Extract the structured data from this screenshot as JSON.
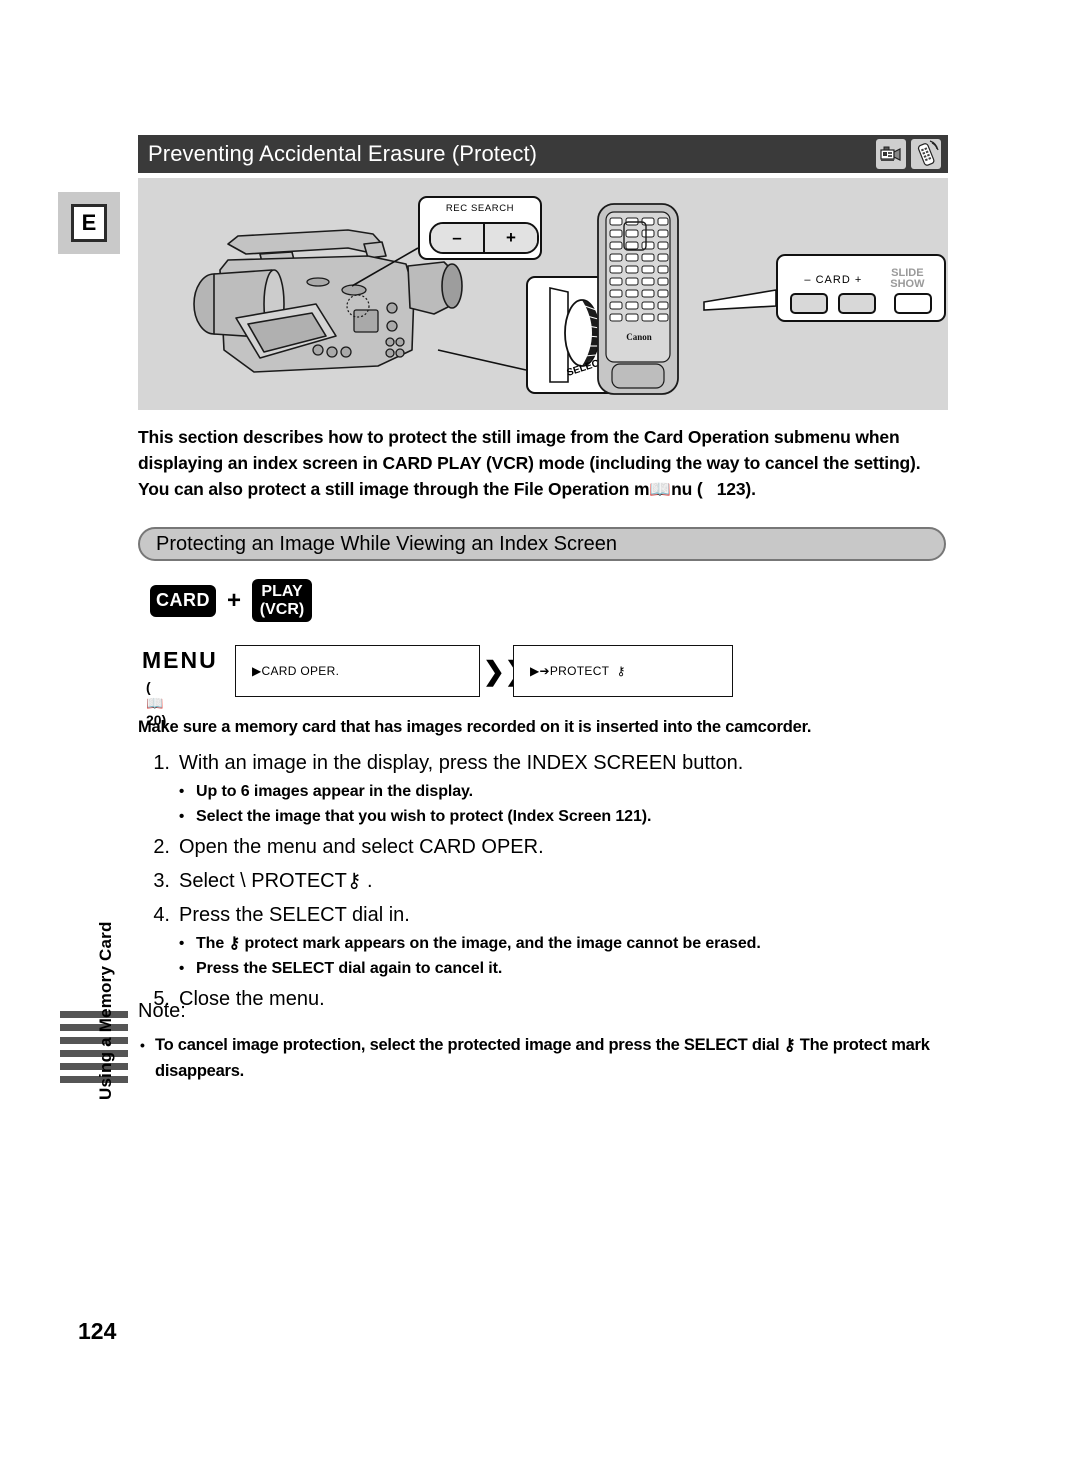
{
  "page": {
    "number": "124",
    "language_tab": "E",
    "side_label": "Using a Memory Card",
    "side_bar_count": 6
  },
  "header": {
    "title": "Preventing Accidental Erasure (Protect)",
    "icons": [
      "camcorder-icon",
      "remote-control-icon"
    ],
    "background": "#3a3a3a",
    "text_color": "#ffffff"
  },
  "diagram": {
    "background": "#d6d6d6",
    "camcorder_alt": "Canon camcorder side view with open LCD panel",
    "remote_alt": "Canon wireless controller remote",
    "remote_brand": "Canon",
    "callouts": {
      "rec_search": {
        "label": "REC SEARCH",
        "minus": "–",
        "plus": "+"
      },
      "select_dial": {
        "label": "SELECT",
        "sub_label": "⏎"
      },
      "remote_card": {
        "minus": "–",
        "card": "CARD",
        "plus": "+",
        "slide_show_line1": "SLIDE",
        "slide_show_line2": "SHOW"
      }
    }
  },
  "intro": {
    "line1": "This section describes how to protect the still image from the Card Operation submenu when",
    "line2": "displaying an index screen in CARD PLAY (VCR) mode (including the way to cancel the setting).",
    "line3_pre": "You can also protect a still image through the File Operation m",
    "line3_post": "nu (",
    "line3_page": "123).",
    "book_glyph": "📖"
  },
  "subheading": "Protecting an Image While Viewing an Index Screen",
  "mode_badges": {
    "card": "CARD",
    "separator": "+",
    "play_line1": "PLAY",
    "play_line2": "(VCR)"
  },
  "menu_path": {
    "menu_word": "MENU",
    "page_ref_open": "(",
    "page_ref_book": "📖",
    "page_ref_number": "20)",
    "box1": "▶CARD OPER.",
    "arrow": "❯❯",
    "box2_pre": "▶➔PROTECT",
    "box2_key": "⚷"
  },
  "make_sure": "Make sure a memory card that has images recorded on it is inserted into the camcorder.",
  "steps": [
    {
      "num": "1.",
      "text": "With an image in the display, press the INDEX SCREEN button.",
      "bullets": [
        "Up to 6 images appear in the display.",
        "Select the image that you wish to protect (Index Screen    121)."
      ]
    },
    {
      "num": "2.",
      "text": "Open the menu and select CARD OPER.",
      "bullets": []
    },
    {
      "num": "3.",
      "text": "Select \\   PROTECT⚷  .",
      "bullets": []
    },
    {
      "num": "4.",
      "text": "Press the SELECT dial in.",
      "bullets": [
        "The ⚷ protect mark appears on the image, and the image cannot be erased.",
        "Press the SELECT dial again to cancel it."
      ]
    },
    {
      "num": "5.",
      "text": "Close the menu.",
      "bullets": []
    }
  ],
  "note": {
    "label": "Note:",
    "items": [
      "To cancel image protection, select the protected image and press the SELECT dial ⚷ The protect mark disappears."
    ]
  }
}
